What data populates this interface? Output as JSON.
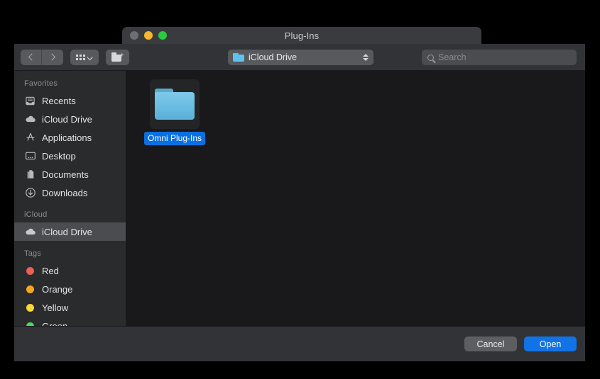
{
  "window": {
    "title": "Plug-Ins",
    "traffic_lights": [
      {
        "name": "close",
        "color": "#6d6e70"
      },
      {
        "name": "minimize",
        "color": "#f7b731"
      },
      {
        "name": "maximize",
        "color": "#2dc940"
      }
    ]
  },
  "toolbar": {
    "back_icon": "chevron-left-icon",
    "forward_icon": "chevron-right-icon",
    "view_icon": "grid-view-icon",
    "view_dropdown_icon": "chevron-down-icon",
    "new_folder_icon": "new-folder-icon",
    "path_popup": {
      "label": "iCloud Drive",
      "icon": "blue-folder-icon",
      "stepper_icon": "up-down-stepper-icon"
    },
    "search": {
      "value": "",
      "placeholder": "Search",
      "icon": "search-icon"
    }
  },
  "sidebar": {
    "sections": [
      {
        "title": "Favorites",
        "items": [
          {
            "label": "Recents",
            "icon": "recents-icon",
            "selected": false
          },
          {
            "label": "iCloud Drive",
            "icon": "cloud-icon",
            "selected": false
          },
          {
            "label": "Applications",
            "icon": "applications-icon",
            "selected": false
          },
          {
            "label": "Desktop",
            "icon": "desktop-icon",
            "selected": false
          },
          {
            "label": "Documents",
            "icon": "documents-icon",
            "selected": false
          },
          {
            "label": "Downloads",
            "icon": "downloads-icon",
            "selected": false
          }
        ]
      },
      {
        "title": "iCloud",
        "items": [
          {
            "label": "iCloud Drive",
            "icon": "cloud-icon",
            "selected": true
          }
        ]
      },
      {
        "title": "Tags",
        "items": [
          {
            "label": "Red",
            "icon": "tag-dot-icon",
            "color": "#ee5f58",
            "selected": false
          },
          {
            "label": "Orange",
            "icon": "tag-dot-icon",
            "color": "#f5a623",
            "selected": false
          },
          {
            "label": "Yellow",
            "icon": "tag-dot-icon",
            "color": "#f7d938",
            "selected": false
          },
          {
            "label": "Green",
            "icon": "tag-dot-icon",
            "color": "#47dd5e",
            "selected": false
          }
        ]
      }
    ]
  },
  "content": {
    "files": [
      {
        "name": "Omni Plug-Ins",
        "icon": "folder-icon",
        "selected": true
      }
    ]
  },
  "footer": {
    "cancel_label": "Cancel",
    "open_label": "Open"
  },
  "colors": {
    "accent": "#1273e6",
    "selection": "#0a6fe0",
    "folder_blue": "#5aa9cd",
    "window_chrome": "#323336",
    "sidebar_bg": "#2a2b2d",
    "content_bg": "#19191b"
  }
}
